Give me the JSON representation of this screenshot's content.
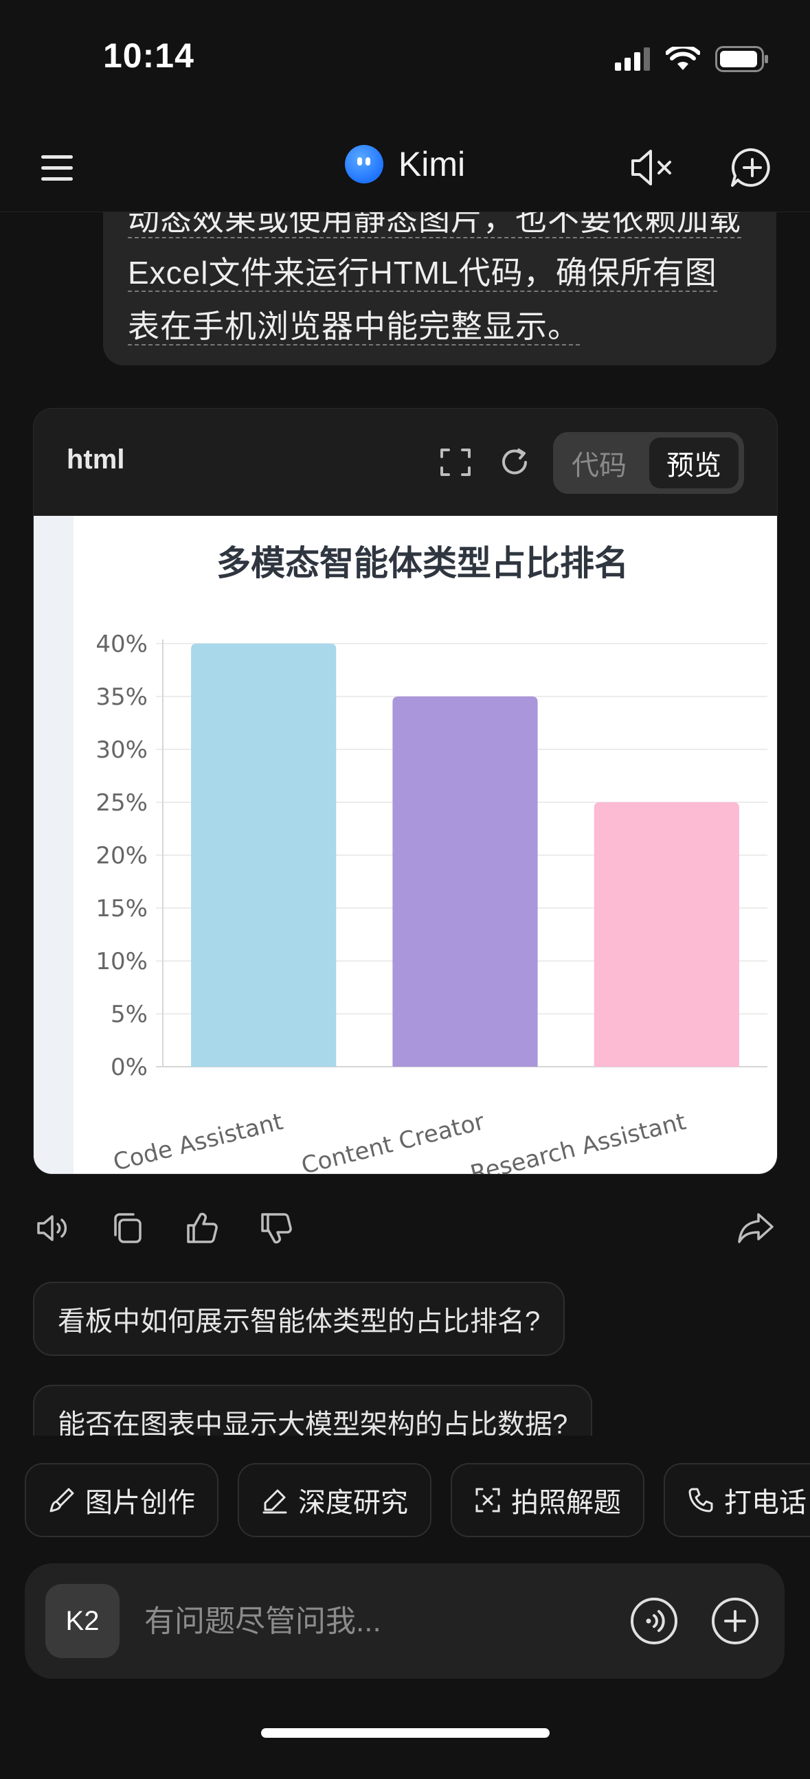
{
  "status": {
    "time": "10:14"
  },
  "header": {
    "title": "Kimi"
  },
  "user_message": {
    "lines": [
      "动态效果或使用静态图片，也不要依赖加载",
      "Excel文件来运行HTML代码，确保所有图",
      "表在手机浏览器中能完整显示。"
    ]
  },
  "code_card": {
    "language": "html",
    "tabs": {
      "code": "代码",
      "preview": "预览"
    }
  },
  "chart_data": {
    "type": "bar",
    "title": "多模态智能体类型占比排名",
    "categories": [
      "Code Assistant",
      "Content Creator",
      "Research Assistant"
    ],
    "values": [
      40,
      35,
      25
    ],
    "y_tick_labels": [
      "0%",
      "5%",
      "10%",
      "15%",
      "20%",
      "25%",
      "30%",
      "35%",
      "40%"
    ],
    "ylim": [
      0,
      40
    ],
    "grid": true,
    "colors": [
      "#a8d8ea",
      "#aa96da",
      "#fcbad3"
    ]
  },
  "suggestions": [
    "看板中如何展示智能体类型的占比排名?",
    "能否在图表中显示大模型架构的占比数据?"
  ],
  "quick_actions": [
    "图片创作",
    "深度研究",
    "拍照解题",
    "打电话"
  ],
  "input": {
    "model": "K2",
    "placeholder": "有问题尽管问我..."
  }
}
